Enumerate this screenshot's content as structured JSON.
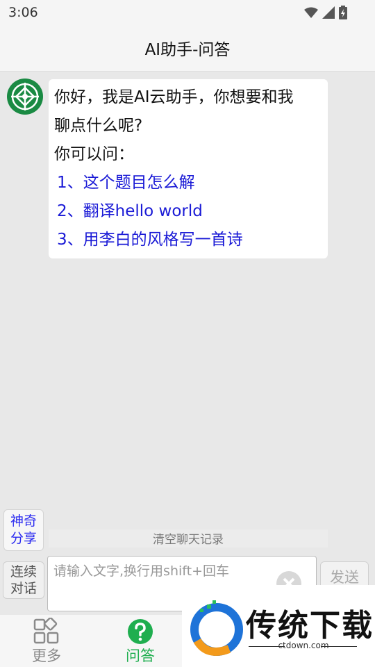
{
  "status_bar": {
    "time": "3:06"
  },
  "header": {
    "title": "AI助手-问答"
  },
  "chat": {
    "bot_message": {
      "lines": [
        "你好，我是AI云助手，你想要和我",
        "聊点什么呢?",
        "你可以问："
      ],
      "suggestions": [
        "1、这个题目怎么解",
        "2、翻译hello world",
        "3、用李白的风格写一首诗"
      ]
    }
  },
  "controls": {
    "share_label_1": "神奇",
    "share_label_2": "分享",
    "clear_history": "清空聊天记录",
    "continuous_label_1": "连续",
    "continuous_label_2": "对话",
    "input_placeholder": "请输入文字,换行用shift+回车",
    "send_label": "发送"
  },
  "bottom_nav": {
    "items": [
      {
        "label": "更多",
        "icon": "grid-icon",
        "active": false
      },
      {
        "label": "问答",
        "icon": "question-icon",
        "active": true
      }
    ]
  },
  "watermark": {
    "title": "传统下载",
    "url": "ctdown.com"
  },
  "colors": {
    "accent_green": "#1fae4f",
    "link_blue": "#1a1ad6",
    "background": "#e8e8e8"
  }
}
